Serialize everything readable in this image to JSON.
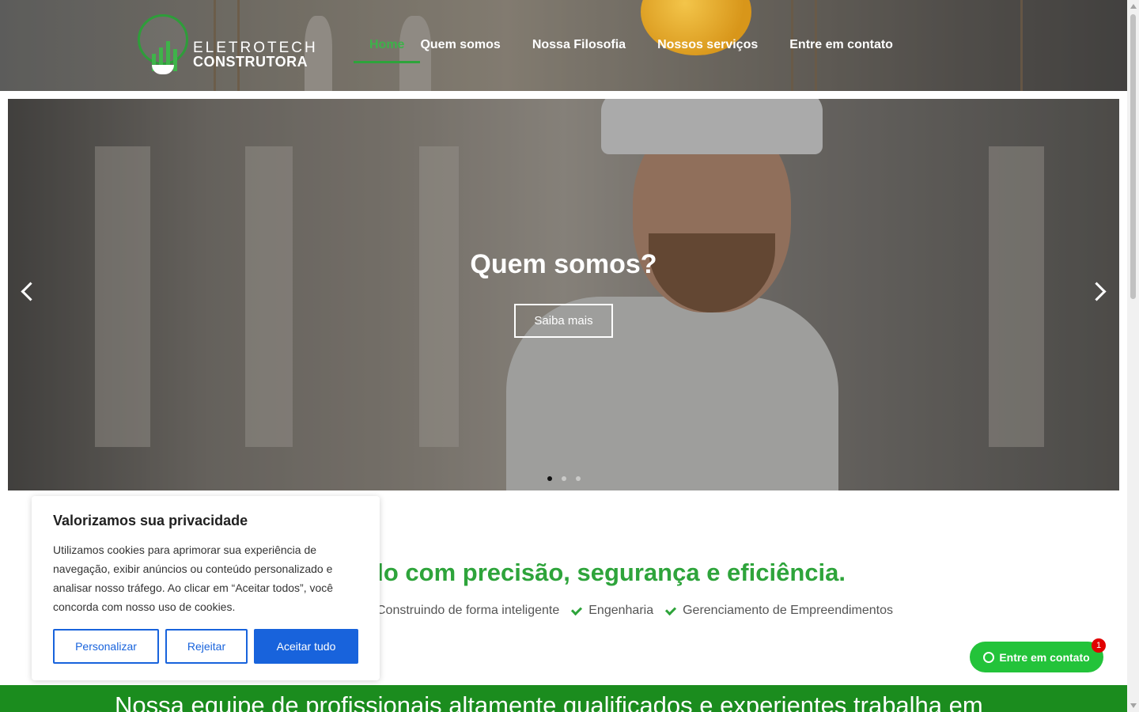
{
  "header": {
    "logo_line1": "ELETROTECH",
    "logo_line2": "CONSTRUTORA",
    "nav": [
      "Home",
      "Quem somos",
      "Nossa Filosofia",
      "Nossos serviços",
      "Entre em contato"
    ],
    "active_index": 0
  },
  "hero": {
    "title": "Quem somos?",
    "button": "Saiba mais",
    "slides_total": 3,
    "active_slide": 1
  },
  "content": {
    "headline": "ndo com precisão, segurança e eficiência.",
    "features": [
      "Construindo de forma inteligente",
      "Engenharia",
      "Gerenciamento de Empreendimentos"
    ],
    "banner": "Nossa equipe de profissionais altamente qualificados e experientes trabalha em"
  },
  "cookie": {
    "title": "Valorizamos sua privacidade",
    "text": "Utilizamos cookies para aprimorar sua experiência de navegação, exibir anúncios ou conteúdo personalizado e analisar nosso tráfego. Ao clicar em “Aceitar todos”, você concorda com nosso uso de cookies.",
    "customize": "Personalizar",
    "reject": "Rejeitar",
    "accept": "Aceitar tudo"
  },
  "whatsapp": {
    "label": "Entre em contato",
    "badge": "1"
  },
  "colors": {
    "brand_green": "#2ea43b",
    "banner_green": "#1b8c1e",
    "accept_blue": "#1863dc",
    "wa_green": "#23c33a"
  },
  "icons": {
    "prev": "chevron-left-icon",
    "next": "chevron-right-icon",
    "check": "check-icon",
    "whatsapp": "whatsapp-icon"
  }
}
